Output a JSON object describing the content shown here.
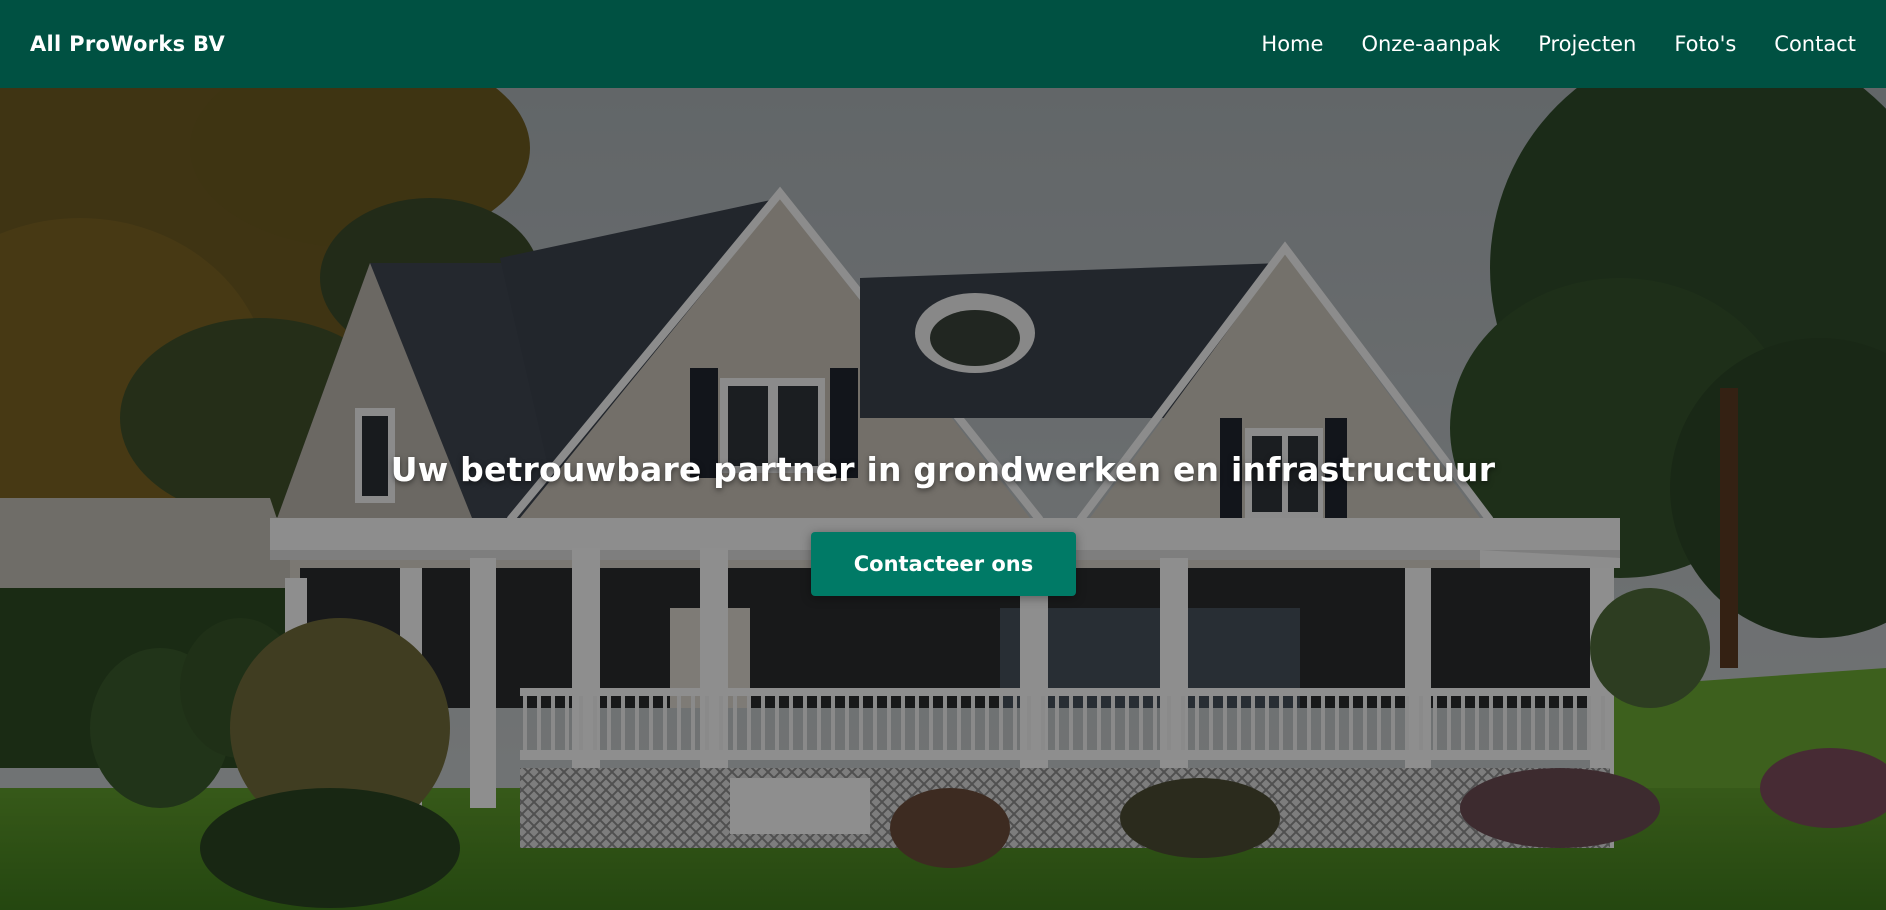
{
  "brand": {
    "name": "All ProWorks BV"
  },
  "nav": {
    "items": [
      {
        "label": "Home"
      },
      {
        "label": "Onze-aanpak"
      },
      {
        "label": "Projecten"
      },
      {
        "label": "Foto's"
      },
      {
        "label": "Contact"
      }
    ]
  },
  "hero": {
    "title": "Uw betrouwbare partner in grondwerken en infrastructuur",
    "cta_label": "Contacteer ons",
    "background_image": "house-photo"
  },
  "colors": {
    "navbar": "#005142",
    "cta": "#007a66",
    "text": "#ffffff"
  }
}
